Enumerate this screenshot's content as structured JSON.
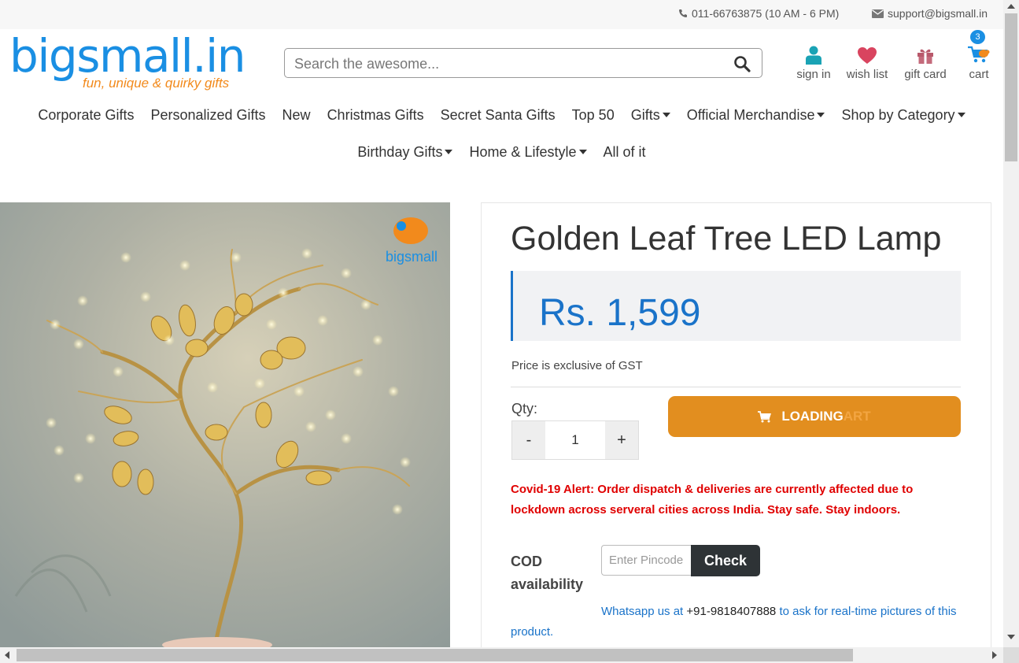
{
  "topbar": {
    "phone": "011-66763875 (10 AM - 6 PM)",
    "email": "support@bigsmall.in"
  },
  "logo": {
    "text": "bigsmall.in",
    "tagline": "fun, unique & quirky gifts"
  },
  "search": {
    "placeholder": "Search the awesome..."
  },
  "header_icons": {
    "signin": "sign in",
    "wishlist": "wish list",
    "giftcard": "gift card",
    "cart": "cart",
    "cart_count": "3"
  },
  "nav": {
    "row1": [
      "Corporate Gifts",
      "Personalized Gifts",
      "New",
      "Christmas Gifts",
      "Secret Santa Gifts",
      "Top 50",
      "Gifts",
      "Official Merchandise",
      "Shop by Category"
    ],
    "row2": [
      "Birthday Gifts",
      "Home & Lifestyle",
      "All of it"
    ]
  },
  "product": {
    "title": "Golden Leaf Tree LED Lamp",
    "price": "Rs. 1,599",
    "gst_note": "Price is exclusive of GST",
    "qty_label": "Qty:",
    "qty_minus": "-",
    "qty_value": "1",
    "qty_plus": "+",
    "add_to_cart_label": "LOADING",
    "add_to_cart_faded": "ART",
    "covid_alert": "Covid-19 Alert: Order dispatch & deliveries are currently affected due to lockdown across serveral cities across India. Stay safe. Stay indoors.",
    "cod_line1": "COD",
    "cod_line2": "availability",
    "pincode_placeholder": "Enter Pincode",
    "check_label": "Check",
    "whatsapp_prefix": "Whatsapp us at ",
    "whatsapp_number": "+91-9818407888",
    "whatsapp_suffix": " to ask for real-time pictures of this product."
  },
  "photo": {
    "watermark": "bigsmall"
  },
  "colors": {
    "brand_blue": "#1a8fe3",
    "brand_orange": "#f28a1c",
    "price_blue": "#1a73c9",
    "cart_button": "#e28e1f",
    "alert_red": "#e00000"
  }
}
